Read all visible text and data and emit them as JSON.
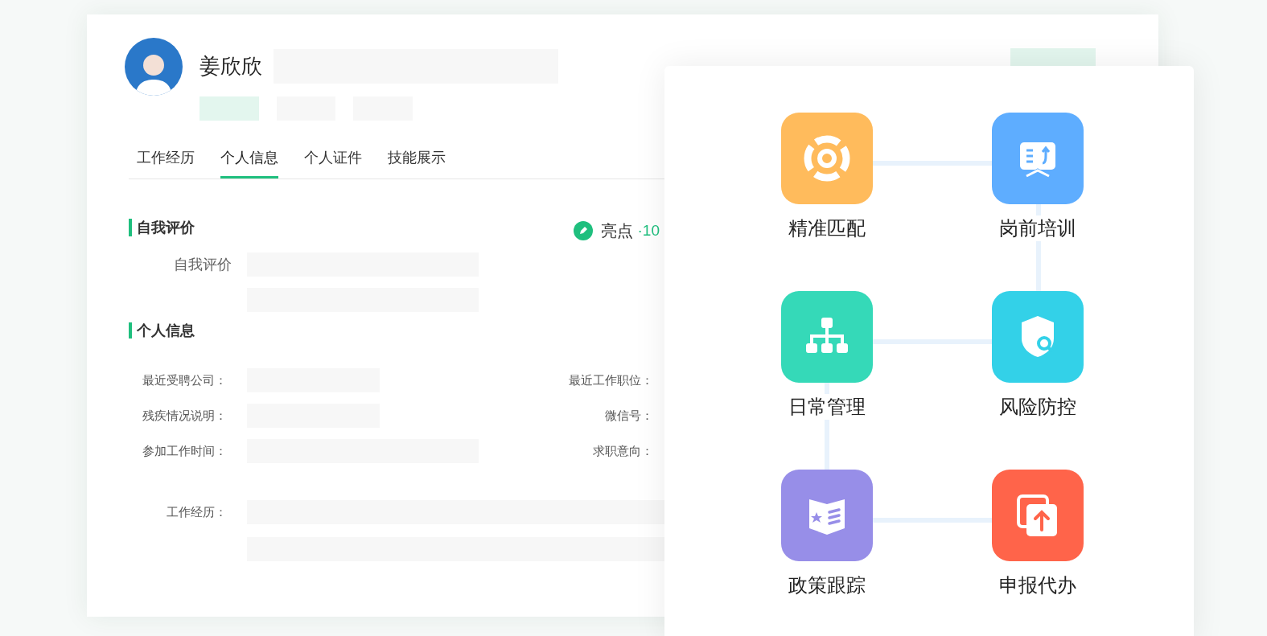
{
  "profile": {
    "name": "姜欣欣"
  },
  "tabs": [
    {
      "label": "工作经历",
      "selected": false
    },
    {
      "label": "个人信息",
      "selected": true
    },
    {
      "label": "个人证件",
      "selected": false
    },
    {
      "label": "技能展示",
      "selected": false
    }
  ],
  "self_review": {
    "title": "自我评价",
    "highlight_label": "亮点",
    "highlight_count": "·10",
    "field_label": "自我评价"
  },
  "personal_info": {
    "title": "个人信息",
    "rows": [
      {
        "label": "最近受聘公司：",
        "right_label": "最近工作职位：",
        "wide": false
      },
      {
        "label": "残疾情况说明：",
        "right_label": "微信号：",
        "wide": false
      },
      {
        "label": "参加工作时间：",
        "right_label": "求职意向：",
        "wide": true
      }
    ],
    "experience_label": "工作经历："
  },
  "features": [
    {
      "label": "精准匹配",
      "color": "#ffbb5c"
    },
    {
      "label": "岗前培训",
      "color": "#5eadff"
    },
    {
      "label": "日常管理",
      "color": "#35d9b8"
    },
    {
      "label": "风险防控",
      "color": "#33d1e8"
    },
    {
      "label": "政策跟踪",
      "color": "#978ee8"
    },
    {
      "label": "申报代办",
      "color": "#ff644a"
    }
  ]
}
